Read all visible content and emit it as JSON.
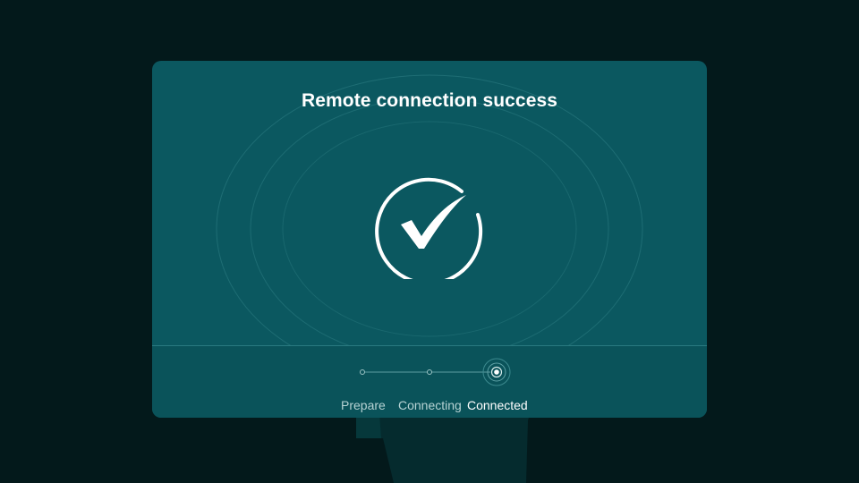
{
  "dialog": {
    "title": "Remote connection success",
    "status_icon": "check-circle-icon"
  },
  "steps": [
    {
      "label": "Prepare",
      "state": "done"
    },
    {
      "label": "Connecting",
      "state": "done"
    },
    {
      "label": "Connected",
      "state": "current"
    }
  ],
  "colors": {
    "background": "#03191b",
    "card": "#0b5860",
    "card_footer": "#0a535a",
    "accent": "#ffffff"
  }
}
